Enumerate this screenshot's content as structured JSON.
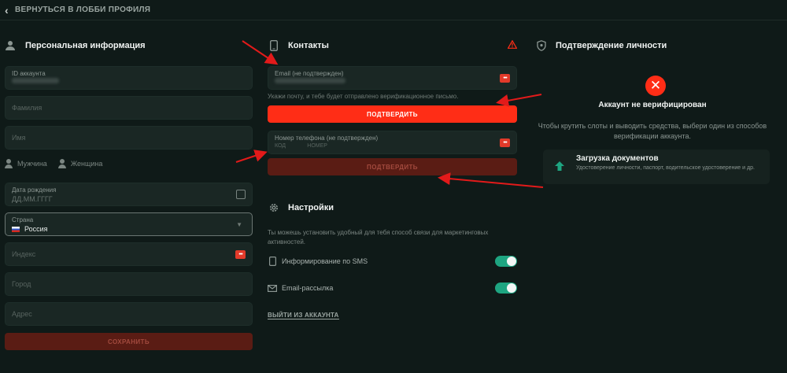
{
  "topbar": {
    "back_label": "ВЕРНУТЬСЯ В ЛОББИ ПРОФИЛЯ"
  },
  "personal": {
    "title": "Персональная информация",
    "account_id_label": "ID аккаунта",
    "surname_placeholder": "Фамилия",
    "name_placeholder": "Имя",
    "gender_male": "Мужчина",
    "gender_female": "Женщина",
    "birthdate_label": "Дата рождения",
    "birthdate_placeholder": "ДД.ММ.ГГГГ",
    "country_label": "Страна",
    "country_value": "Россия",
    "zip_placeholder": "Индекс",
    "city_placeholder": "Город",
    "address_placeholder": "Адрес",
    "save_button": "СОХРАНИТЬ"
  },
  "contacts": {
    "title": "Контакты",
    "email_label": "Email (не подтвержден)",
    "email_hint": "Укажи почту, и тебе будет отправлено верификационное письмо.",
    "confirm_button": "ПОДТВЕРДИТЬ",
    "phone_label": "Номер телефона (не подтвержден)",
    "phone_value": "КОД",
    "phone_value_2": "НОМЕР",
    "confirm_button_2": "ПОДТВЕРДИТЬ"
  },
  "settings": {
    "title": "Настройки",
    "description": "Ты можешь установить удобный для тебя способ связи для маркетинговых активностей.",
    "sms_label": "Информирование по SMS",
    "email_label": "Email-рассылка",
    "logout": "ВЫЙТИ ИЗ АККАУНТА"
  },
  "verification": {
    "title": "Подтверждение личности",
    "status": "Аккаунт не верифицирован",
    "description": "Чтобы крутить слоты и выводить средства, выбери один из способов верификации аккаунта.",
    "doc_title": "Загрузка документов",
    "doc_subtitle": "Удостоверение личности, паспорт, водительское удостоверение и др."
  },
  "colors": {
    "accent": "#ff2d16",
    "toggle_on": "#1ea581",
    "background": "#0f1a18"
  }
}
